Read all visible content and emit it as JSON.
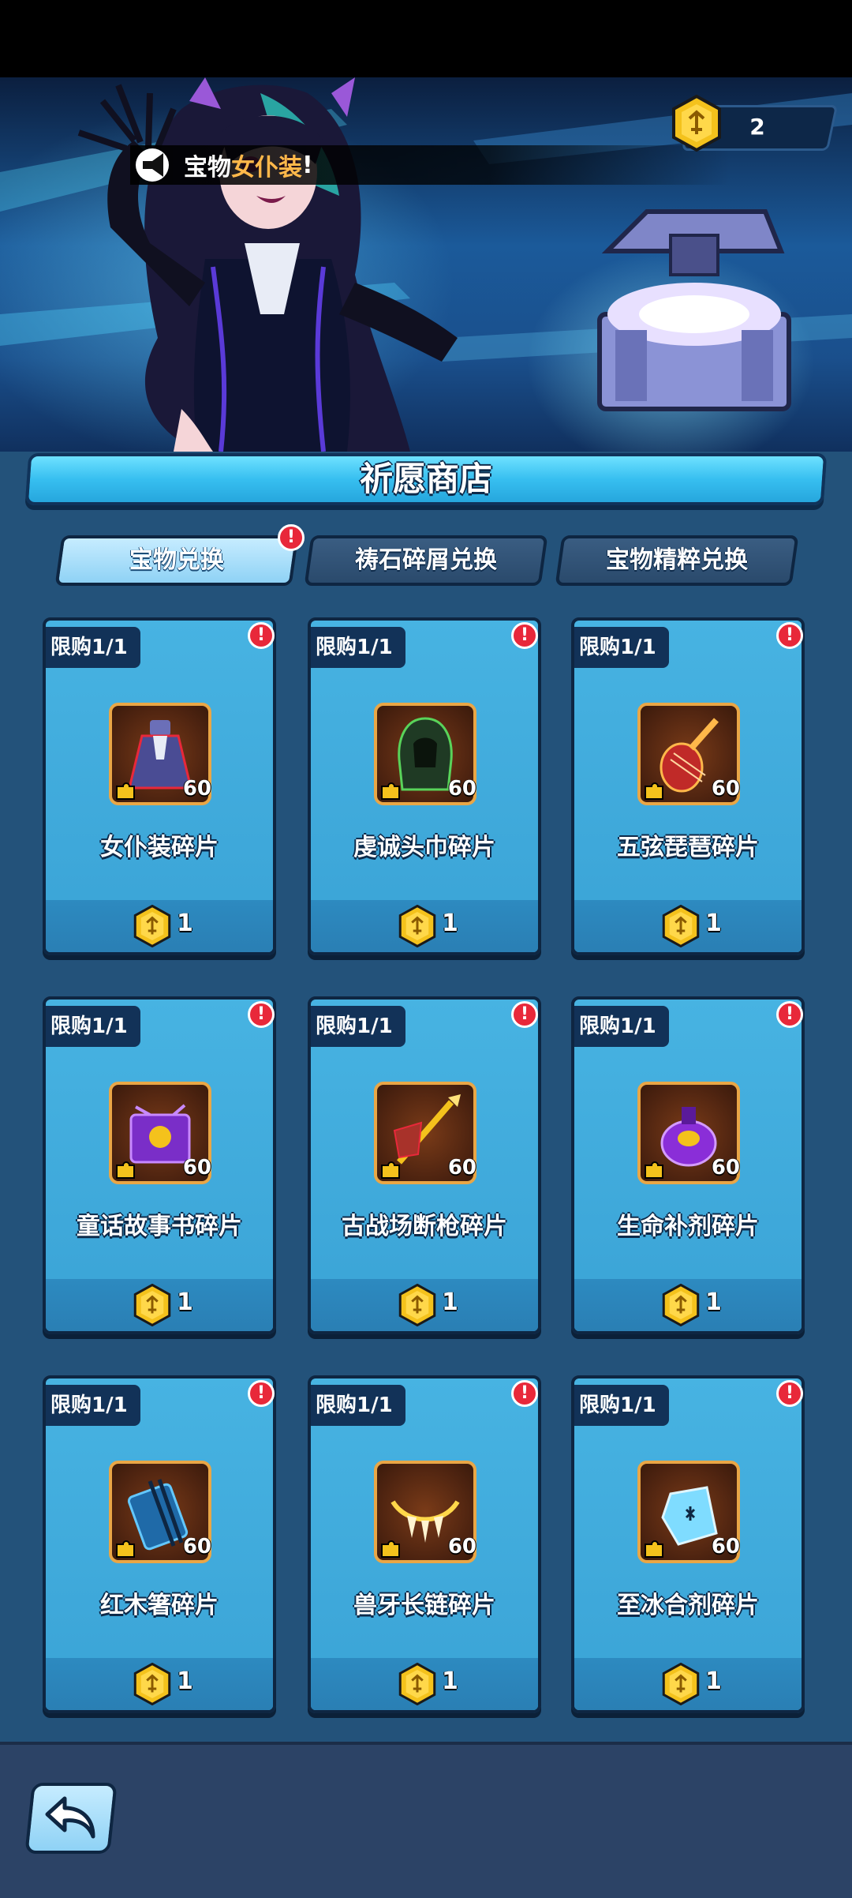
{
  "banner": {
    "notice_prefix": "宝物",
    "notice_highlight": "女仆装",
    "notice_suffix": "!",
    "coin_count": "2"
  },
  "title": "祈愿商店",
  "tabs": [
    {
      "label": "宝物兑换",
      "active": true,
      "badge": "!"
    },
    {
      "label": "祷石碎屑兑换",
      "active": false
    },
    {
      "label": "宝物精粹兑换",
      "active": false
    }
  ],
  "items": [
    {
      "limit": "限购1/1",
      "name": "女仆装碎片",
      "qty": "60",
      "price": "1",
      "icon": "maid-dress-icon",
      "badge": "!"
    },
    {
      "limit": "限购1/1",
      "name": "虔诚头巾碎片",
      "qty": "60",
      "price": "1",
      "icon": "green-hood-icon",
      "badge": "!"
    },
    {
      "limit": "限购1/1",
      "name": "五弦琵琶碎片",
      "qty": "60",
      "price": "1",
      "icon": "pipa-lute-icon",
      "badge": "!"
    },
    {
      "limit": "限购1/1",
      "name": "童话故事书碎片",
      "qty": "60",
      "price": "1",
      "icon": "storybook-icon",
      "badge": "!"
    },
    {
      "limit": "限购1/1",
      "name": "古战场断枪碎片",
      "qty": "60",
      "price": "1",
      "icon": "broken-spear-icon",
      "badge": "!"
    },
    {
      "limit": "限购1/1",
      "name": "生命补剂碎片",
      "qty": "60",
      "price": "1",
      "icon": "potion-icon",
      "badge": "!"
    },
    {
      "limit": "限购1/1",
      "name": "红木箸碎片",
      "qty": "60",
      "price": "1",
      "icon": "chopsticks-box-icon",
      "badge": "!"
    },
    {
      "limit": "限购1/1",
      "name": "兽牙长链碎片",
      "qty": "60",
      "price": "1",
      "icon": "fang-chain-icon",
      "badge": "!"
    },
    {
      "limit": "限购1/1",
      "name": "至冰合剂碎片",
      "qty": "60",
      "price": "1",
      "icon": "ice-flask-icon",
      "badge": "!"
    }
  ],
  "colors": {
    "accent_blue": "#37bff0",
    "card_blue": "#3aa3d6",
    "frame_gold": "#e9a646",
    "badge_red": "#e8283a",
    "highlight_orange": "#ffb84a"
  },
  "back_button_icon": "back-arrow-icon"
}
